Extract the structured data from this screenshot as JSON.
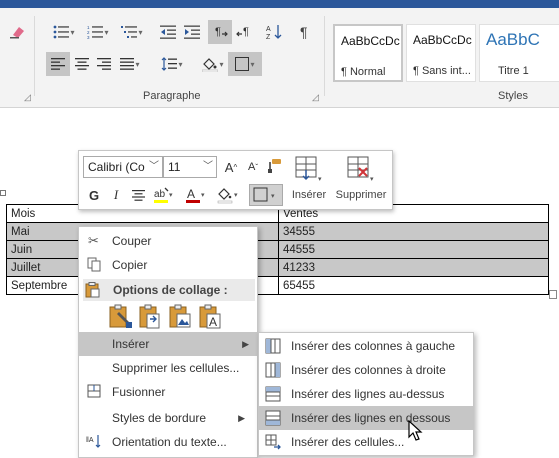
{
  "ribbon": {
    "paragraph_group_label": "Paragraphe",
    "styles_group_label": "Styles",
    "styles": [
      {
        "preview": "AaBbCcDc",
        "name": "¶ Normal"
      },
      {
        "preview": "AaBbCcDc",
        "name": "¶ Sans int..."
      },
      {
        "preview": "AaBbC",
        "name": "Titre 1"
      }
    ]
  },
  "mini_toolbar": {
    "font_name": "Calibri (Co",
    "font_size": "11",
    "insert_label": "Insérer",
    "delete_label": "Supprimer",
    "bold_label": "G",
    "italic_label": "I",
    "highlight_color": "#ffff00",
    "font_color": "#c00000"
  },
  "table": {
    "header": [
      "Mois",
      "Ventes"
    ],
    "rows": [
      [
        "Mai",
        "34555"
      ],
      [
        "Juin",
        "44555"
      ],
      [
        "Juillet",
        "41233"
      ],
      [
        "Septembre",
        "65455"
      ]
    ]
  },
  "context_menu": {
    "cut": "Couper",
    "copy": "Copier",
    "paste_options": "Options de collage :",
    "insert": "Insérer",
    "delete_cells": "Supprimer les cellules...",
    "merge": "Fusionner",
    "border_styles": "Styles de bordure",
    "text_direction": "Orientation du texte..."
  },
  "insert_submenu": {
    "cols_left": "Insérer des colonnes à gauche",
    "cols_right": "Insérer des colonnes à droite",
    "rows_above": "Insérer des lignes au-dessus",
    "rows_below": "Insérer des lignes en dessous",
    "cells": "Insérer des cellules..."
  },
  "colors": {
    "word_blue": "#2b579a",
    "ribbon_bg": "#f3f3f3",
    "selection_gray": "#c8c8c8",
    "menu_hover": "#c6c6c6"
  }
}
